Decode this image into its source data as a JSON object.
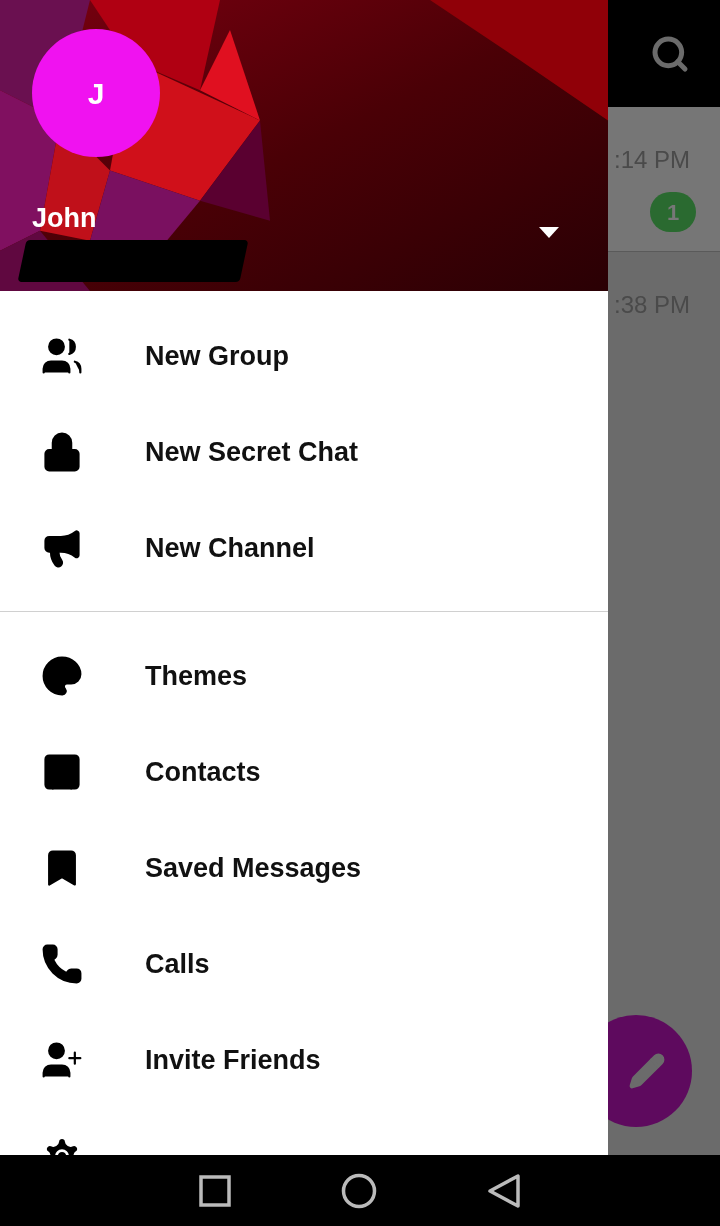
{
  "drawer": {
    "header": {
      "avatar_initial": "J",
      "name": "John"
    },
    "sections": [
      {
        "items": [
          {
            "label": "New Group"
          },
          {
            "label": "New Secret Chat"
          },
          {
            "label": "New Channel"
          }
        ]
      },
      {
        "items": [
          {
            "label": "Themes"
          },
          {
            "label": "Contacts"
          },
          {
            "label": "Saved Messages"
          },
          {
            "label": "Calls"
          },
          {
            "label": "Invite Friends"
          }
        ]
      }
    ]
  },
  "chat_list": {
    "rows": [
      {
        "time": ":14 PM",
        "unread": "1"
      },
      {
        "time": ":38 PM"
      }
    ]
  }
}
